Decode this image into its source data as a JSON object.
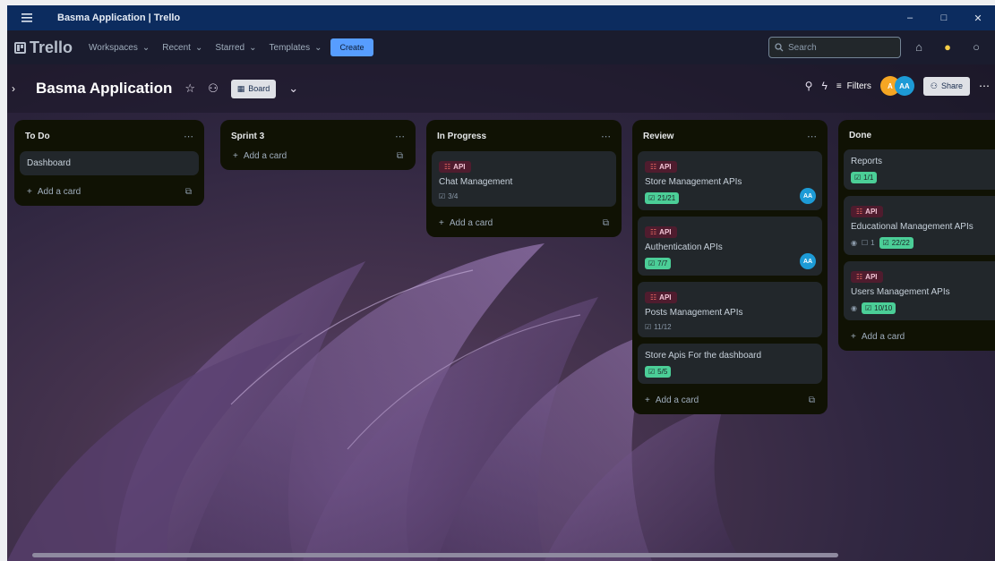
{
  "window": {
    "title": "Basma Application | Trello",
    "controls": [
      "–",
      "□",
      "✕"
    ]
  },
  "header": {
    "logo": "Trello",
    "nav": [
      "Workspaces",
      "Recent",
      "Starred",
      "Templates"
    ],
    "create_label": "Create",
    "search_placeholder": "Search"
  },
  "board": {
    "title": "Basma Application",
    "view_label": "Board",
    "filters_label": "Filters",
    "share_label": "Share",
    "members": [
      "A",
      "AA"
    ]
  },
  "lists": [
    {
      "title": "To Do",
      "cards": [
        {
          "title": "Dashboard"
        }
      ],
      "add_label": "Add a card"
    },
    {
      "title": "Sprint 3",
      "cards": [],
      "add_label": "Add a card"
    },
    {
      "title": "In Progress",
      "cards": [
        {
          "label": "API",
          "title": "Chat Management",
          "checklist": "3/4",
          "checklist_done": false
        }
      ],
      "add_label": "Add a card"
    },
    {
      "title": "Review",
      "cards": [
        {
          "label": "API",
          "title": "Store Management APIs",
          "checklist": "21/21",
          "checklist_done": true,
          "member": "AA"
        },
        {
          "label": "API",
          "title": "Authentication APIs",
          "checklist": "7/7",
          "checklist_done": true,
          "member": "AA"
        },
        {
          "label": "API",
          "title": "Posts Management APIs",
          "checklist": "11/12",
          "checklist_done": false
        },
        {
          "title": "Store Apis For the dashboard",
          "checklist": "5/5",
          "checklist_done": true
        }
      ],
      "add_label": "Add a card"
    },
    {
      "title": "Done",
      "cards": [
        {
          "title": "Reports",
          "checklist": "1/1",
          "checklist_done": true
        },
        {
          "label": "API",
          "title": "Educational Management APIs",
          "comments": "1",
          "checklist": "22/22",
          "checklist_done": true
        },
        {
          "label": "API",
          "title": "Users Management APIs",
          "checklist": "10/10",
          "checklist_done": true
        }
      ],
      "add_label": "Add a card"
    }
  ],
  "colors": {
    "titlebar": "#0c2c5f",
    "create": "#579dff",
    "label_api": "#4f1c2e",
    "checklist_done": "#4bce97",
    "list_bg": "#101204",
    "card_bg": "#22272b"
  }
}
